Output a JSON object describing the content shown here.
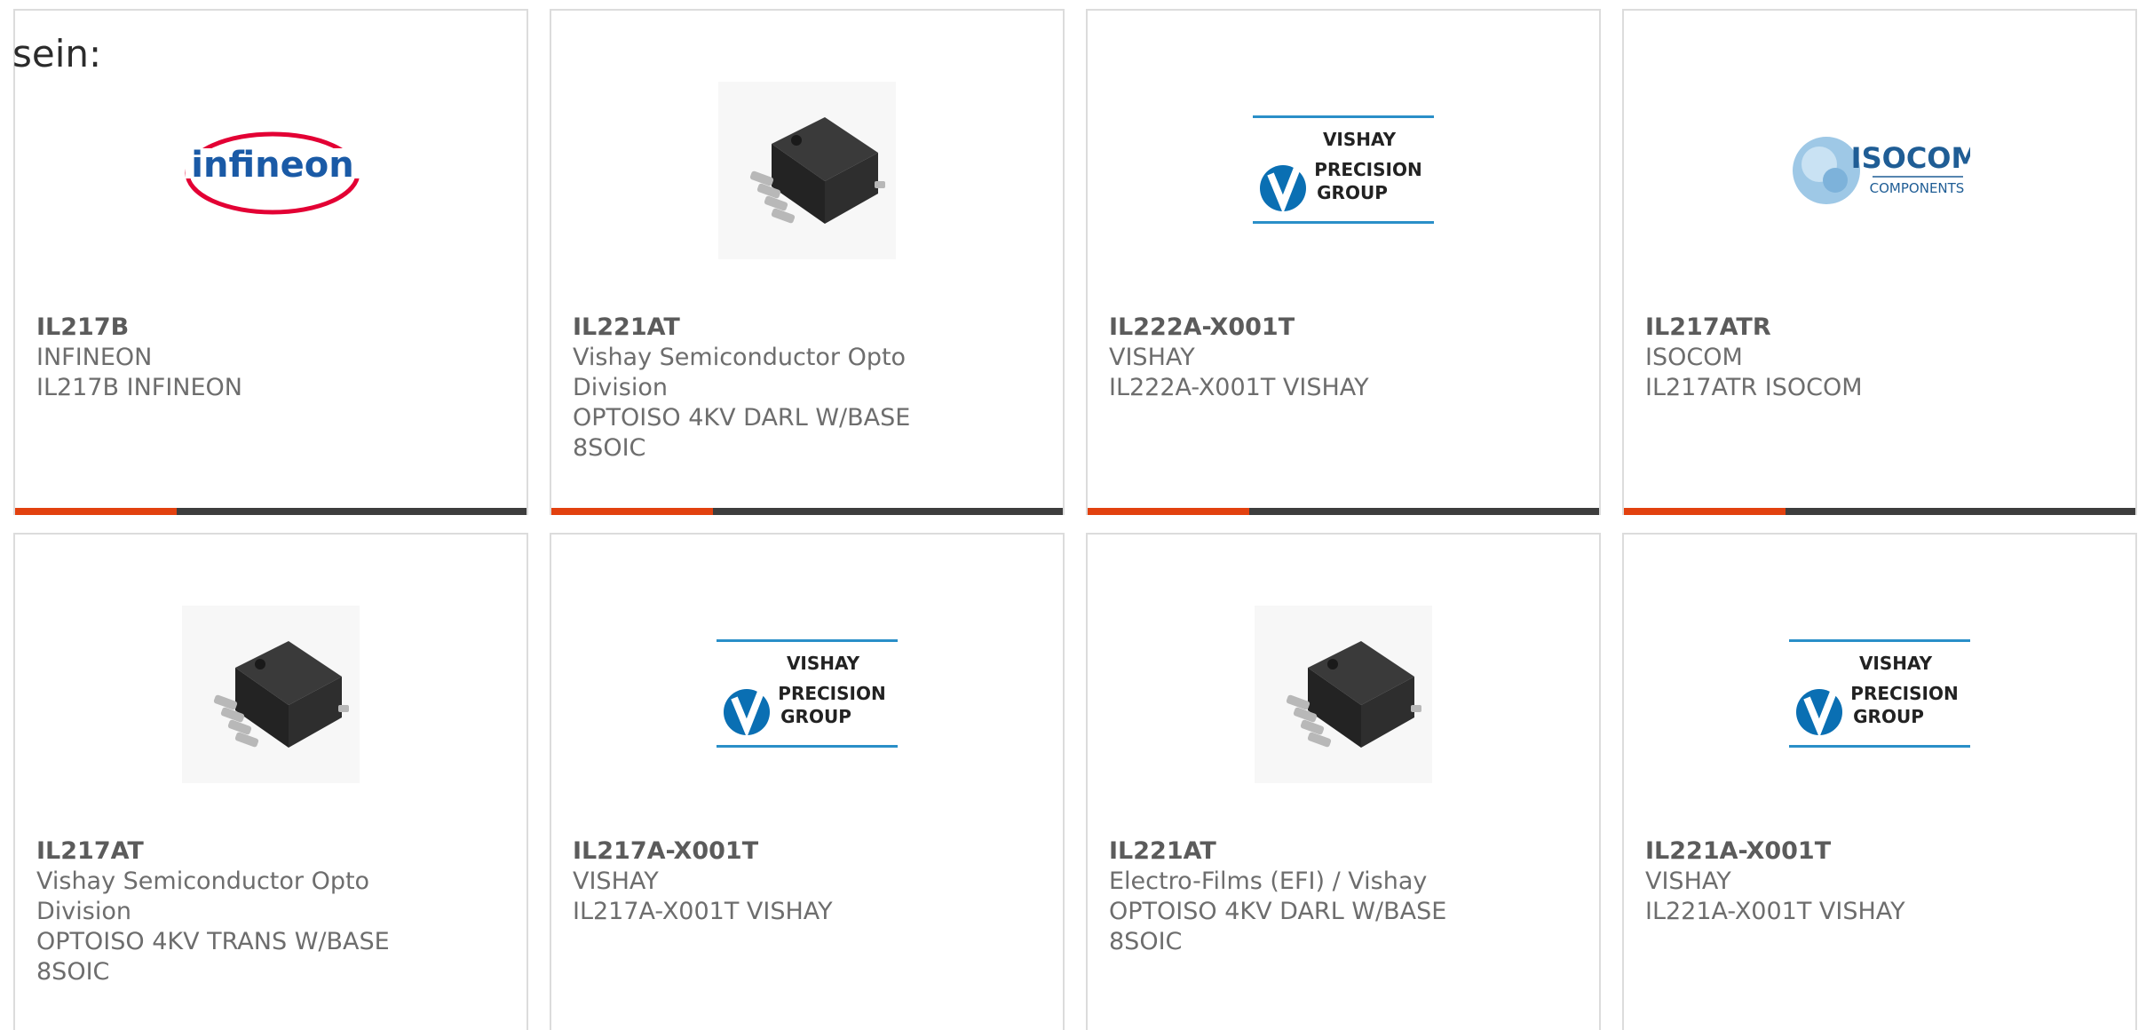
{
  "intro_text": "sein:",
  "colors": {
    "accent": "#e2410f",
    "bar": "#3d3d3d",
    "border": "#dcdcdc",
    "text": "#6d6d6d"
  },
  "products": [
    {
      "part": "IL217B",
      "manufacturer": "INFINEON",
      "description": "IL217B INFINEON",
      "image": "infineon-logo"
    },
    {
      "part": "IL221AT",
      "manufacturer": "Vishay Semiconductor Opto Division",
      "description": "OPTOISO 4KV DARL W/BASE 8SOIC",
      "image": "soic-chip"
    },
    {
      "part": "IL222A-X001T",
      "manufacturer": "VISHAY",
      "description": "IL222A-X001T VISHAY",
      "image": "vishay-precision-logo"
    },
    {
      "part": "IL217ATR",
      "manufacturer": "ISOCOM",
      "description": "IL217ATR ISOCOM",
      "image": "isocom-logo"
    },
    {
      "part": "IL217AT",
      "manufacturer": "Vishay Semiconductor Opto Division",
      "description": "OPTOISO 4KV TRANS W/BASE 8SOIC",
      "image": "soic-chip"
    },
    {
      "part": "IL217A-X001T",
      "manufacturer": "VISHAY",
      "description": "IL217A-X001T VISHAY",
      "image": "vishay-precision-logo"
    },
    {
      "part": "IL221AT",
      "manufacturer": "Electro-Films (EFI) / Vishay",
      "description": "OPTOISO 4KV DARL W/BASE 8SOIC",
      "image": "soic-chip"
    },
    {
      "part": "IL221A-X001T",
      "manufacturer": "VISHAY",
      "description": "IL221A-X001T VISHAY",
      "image": "vishay-precision-logo"
    }
  ],
  "logos": {
    "infineon": "infineon",
    "vishay": [
      "VISHAY",
      "PRECISION",
      "GROUP"
    ],
    "isocom": [
      "ISOCOM",
      "COMPONENTS"
    ]
  }
}
